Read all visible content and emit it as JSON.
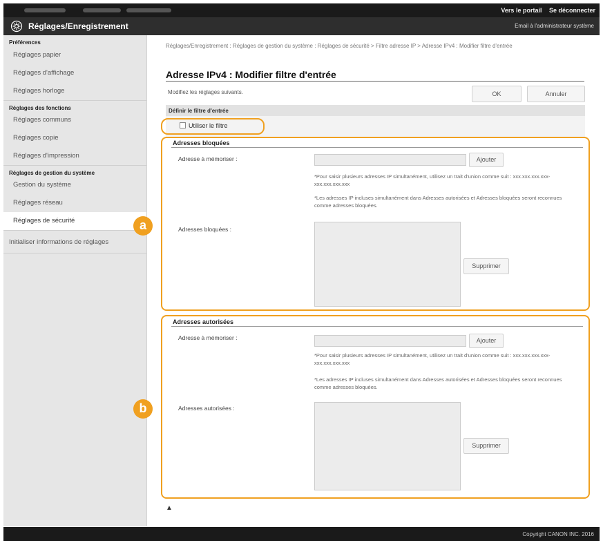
{
  "top_links": {
    "portal": "Vers le portail",
    "logout": "Se déconnecter"
  },
  "header": {
    "title": "Réglages/Enregistrement",
    "email_admin": "Email à l'administrateur système"
  },
  "sidebar": {
    "sections": [
      {
        "label": "Préférences",
        "items": [
          "Réglages papier",
          "Réglages d'affichage",
          "Réglages horloge"
        ]
      },
      {
        "label": "Réglages des fonctions",
        "items": [
          "Réglages communs",
          "Réglages copie",
          "Réglages d'impression"
        ]
      },
      {
        "label": "Réglages de gestion du système",
        "items": [
          "Gestion du système",
          "Réglages réseau",
          "Réglages de sécurité"
        ]
      }
    ],
    "extra_item": "Initialiser informations de réglages",
    "active_item": "Réglages de sécurité"
  },
  "main": {
    "breadcrumb": "Réglages/Enregistrement : Réglages de gestion du système : Réglages de sécurité > Filtre adresse IP > Adresse IPv4 : Modifier filtre d'entrée",
    "title": "Adresse IPv4 : Modifier filtre d'entrée",
    "instruction": "Modifiez les réglages suivants.",
    "ok_label": "OK",
    "cancel_label": "Annuler",
    "filter_header": "Définir le filtre d'entrée",
    "use_filter_label": "Utiliser le filtre",
    "use_filter_checked": false,
    "blocked": {
      "title": "Adresses bloquées",
      "address_label": "Adresse à mémoriser :",
      "add_label": "Ajouter",
      "note1": "*Pour saisir plusieurs adresses IP simultanément, utilisez un trait d'union comme suit : xxx.xxx.xxx.xxx-xxx.xxx.xxx.xxx",
      "note2": "*Les adresses IP incluses simultanément dans Adresses autorisées et Adresses bloquées seront reconnues comme adresses bloquées.",
      "list_label": "Adresses bloquées :",
      "delete_label": "Supprimer"
    },
    "allowed": {
      "title": "Adresses autorisées",
      "address_label": "Adresse à mémoriser :",
      "add_label": "Ajouter",
      "note1": "*Pour saisir plusieurs adresses IP simultanément, utilisez un trait d'union comme suit : xxx.xxx.xxx.xxx-xxx.xxx.xxx.xxx",
      "note2": "*Les adresses IP incluses simultanément dans Adresses autorisées et Adresses bloquées seront reconnues comme adresses bloquées.",
      "list_label": "Adresses autorisées :",
      "delete_label": "Supprimer"
    },
    "scroll_top_icon": "▲"
  },
  "callouts": {
    "a": "a",
    "b": "b"
  },
  "footer": {
    "copyright": "Copyright CANON INC. 2016"
  },
  "colors": {
    "highlight": "#f0a020",
    "topbar": "#1a1a1a",
    "titlebar": "#2e2e2e",
    "sidebar": "#e6e6e6"
  },
  "icons": {
    "header": "gear-icon",
    "scroll_top": "scroll-top-icon"
  }
}
